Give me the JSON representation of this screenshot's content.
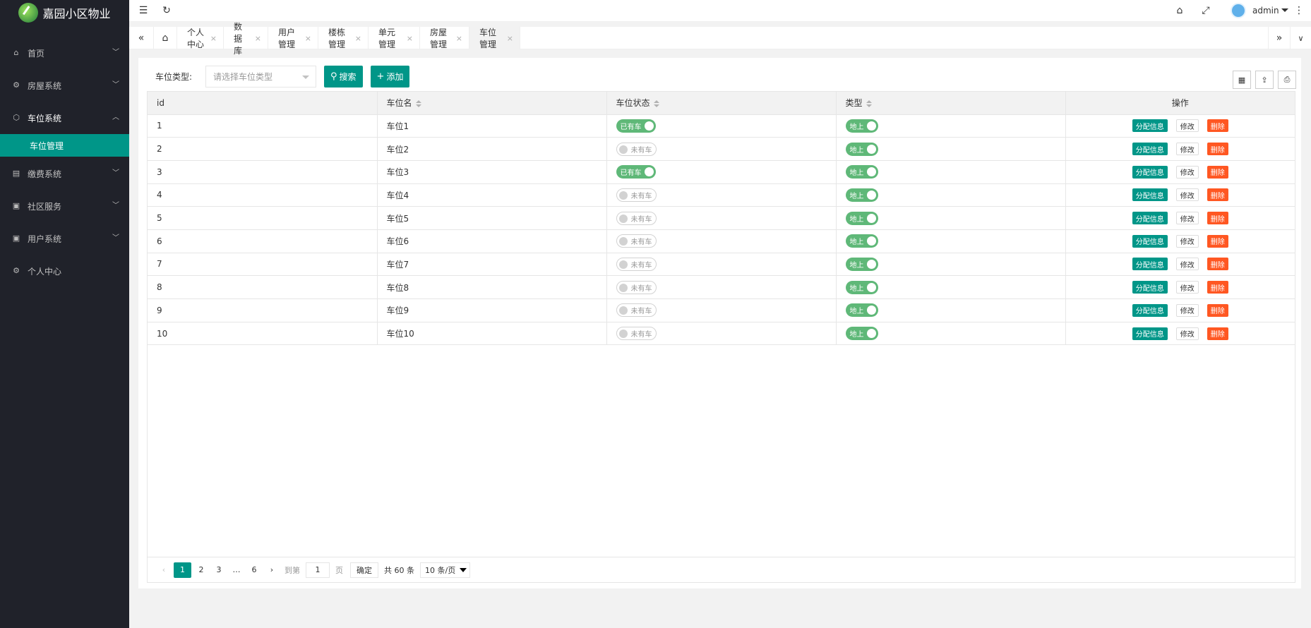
{
  "app": {
    "title": "嘉园小区物业"
  },
  "sidebar": {
    "items": [
      {
        "label": "首页",
        "icon": "home-icon",
        "has_arrow": true
      },
      {
        "label": "房屋系统",
        "icon": "gear-icon",
        "has_arrow": true
      },
      {
        "label": "车位系统",
        "icon": "cube-icon",
        "has_arrow": true,
        "open": true
      },
      {
        "label": "缴费系统",
        "icon": "ledger-icon",
        "has_arrow": true
      },
      {
        "label": "社区服务",
        "icon": "grid-icon",
        "has_arrow": true
      },
      {
        "label": "用户系统",
        "icon": "grid-icon",
        "has_arrow": true
      },
      {
        "label": "个人中心",
        "icon": "gear-icon",
        "has_arrow": false
      }
    ],
    "sub_active": "车位管理"
  },
  "header": {
    "user": "admin"
  },
  "tabs": [
    {
      "label": "个人中心"
    },
    {
      "label": "数据库"
    },
    {
      "label": "用户管理"
    },
    {
      "label": "楼栋管理"
    },
    {
      "label": "单元管理"
    },
    {
      "label": "房屋管理"
    },
    {
      "label": "车位管理",
      "active": true
    }
  ],
  "search": {
    "label": "车位类型:",
    "placeholder": "请选择车位类型",
    "search_button": "搜索",
    "add_button": "添加"
  },
  "table": {
    "columns": [
      "id",
      "车位名",
      "车位状态",
      "类型",
      "操作"
    ],
    "rows": [
      {
        "id": "1",
        "name": "车位1",
        "status": "已有车",
        "status_on": true,
        "type": "地上"
      },
      {
        "id": "2",
        "name": "车位2",
        "status": "未有车",
        "status_on": false,
        "type": "地上"
      },
      {
        "id": "3",
        "name": "车位3",
        "status": "已有车",
        "status_on": true,
        "type": "地上"
      },
      {
        "id": "4",
        "name": "车位4",
        "status": "未有车",
        "status_on": false,
        "type": "地上"
      },
      {
        "id": "5",
        "name": "车位5",
        "status": "未有车",
        "status_on": false,
        "type": "地上"
      },
      {
        "id": "6",
        "name": "车位6",
        "status": "未有车",
        "status_on": false,
        "type": "地上"
      },
      {
        "id": "7",
        "name": "车位7",
        "status": "未有车",
        "status_on": false,
        "type": "地上"
      },
      {
        "id": "8",
        "name": "车位8",
        "status": "未有车",
        "status_on": false,
        "type": "地上"
      },
      {
        "id": "9",
        "name": "车位9",
        "status": "未有车",
        "status_on": false,
        "type": "地上"
      },
      {
        "id": "10",
        "name": "车位10",
        "status": "未有车",
        "status_on": false,
        "type": "地上"
      }
    ],
    "ops": {
      "assign": "分配信息",
      "edit": "修改",
      "delete": "删除"
    }
  },
  "pager": {
    "pages": [
      "1",
      "2",
      "3",
      "…",
      "6"
    ],
    "current": "1",
    "goto_label": "到第",
    "goto_value": "1",
    "page_unit": "页",
    "confirm": "确定",
    "total": "共 60 条",
    "limit": "10 条/页"
  },
  "colors": {
    "primary": "#009688",
    "danger": "#ff5722",
    "switch_on": "#5fb878",
    "sidebar_bg": "#20222a"
  }
}
